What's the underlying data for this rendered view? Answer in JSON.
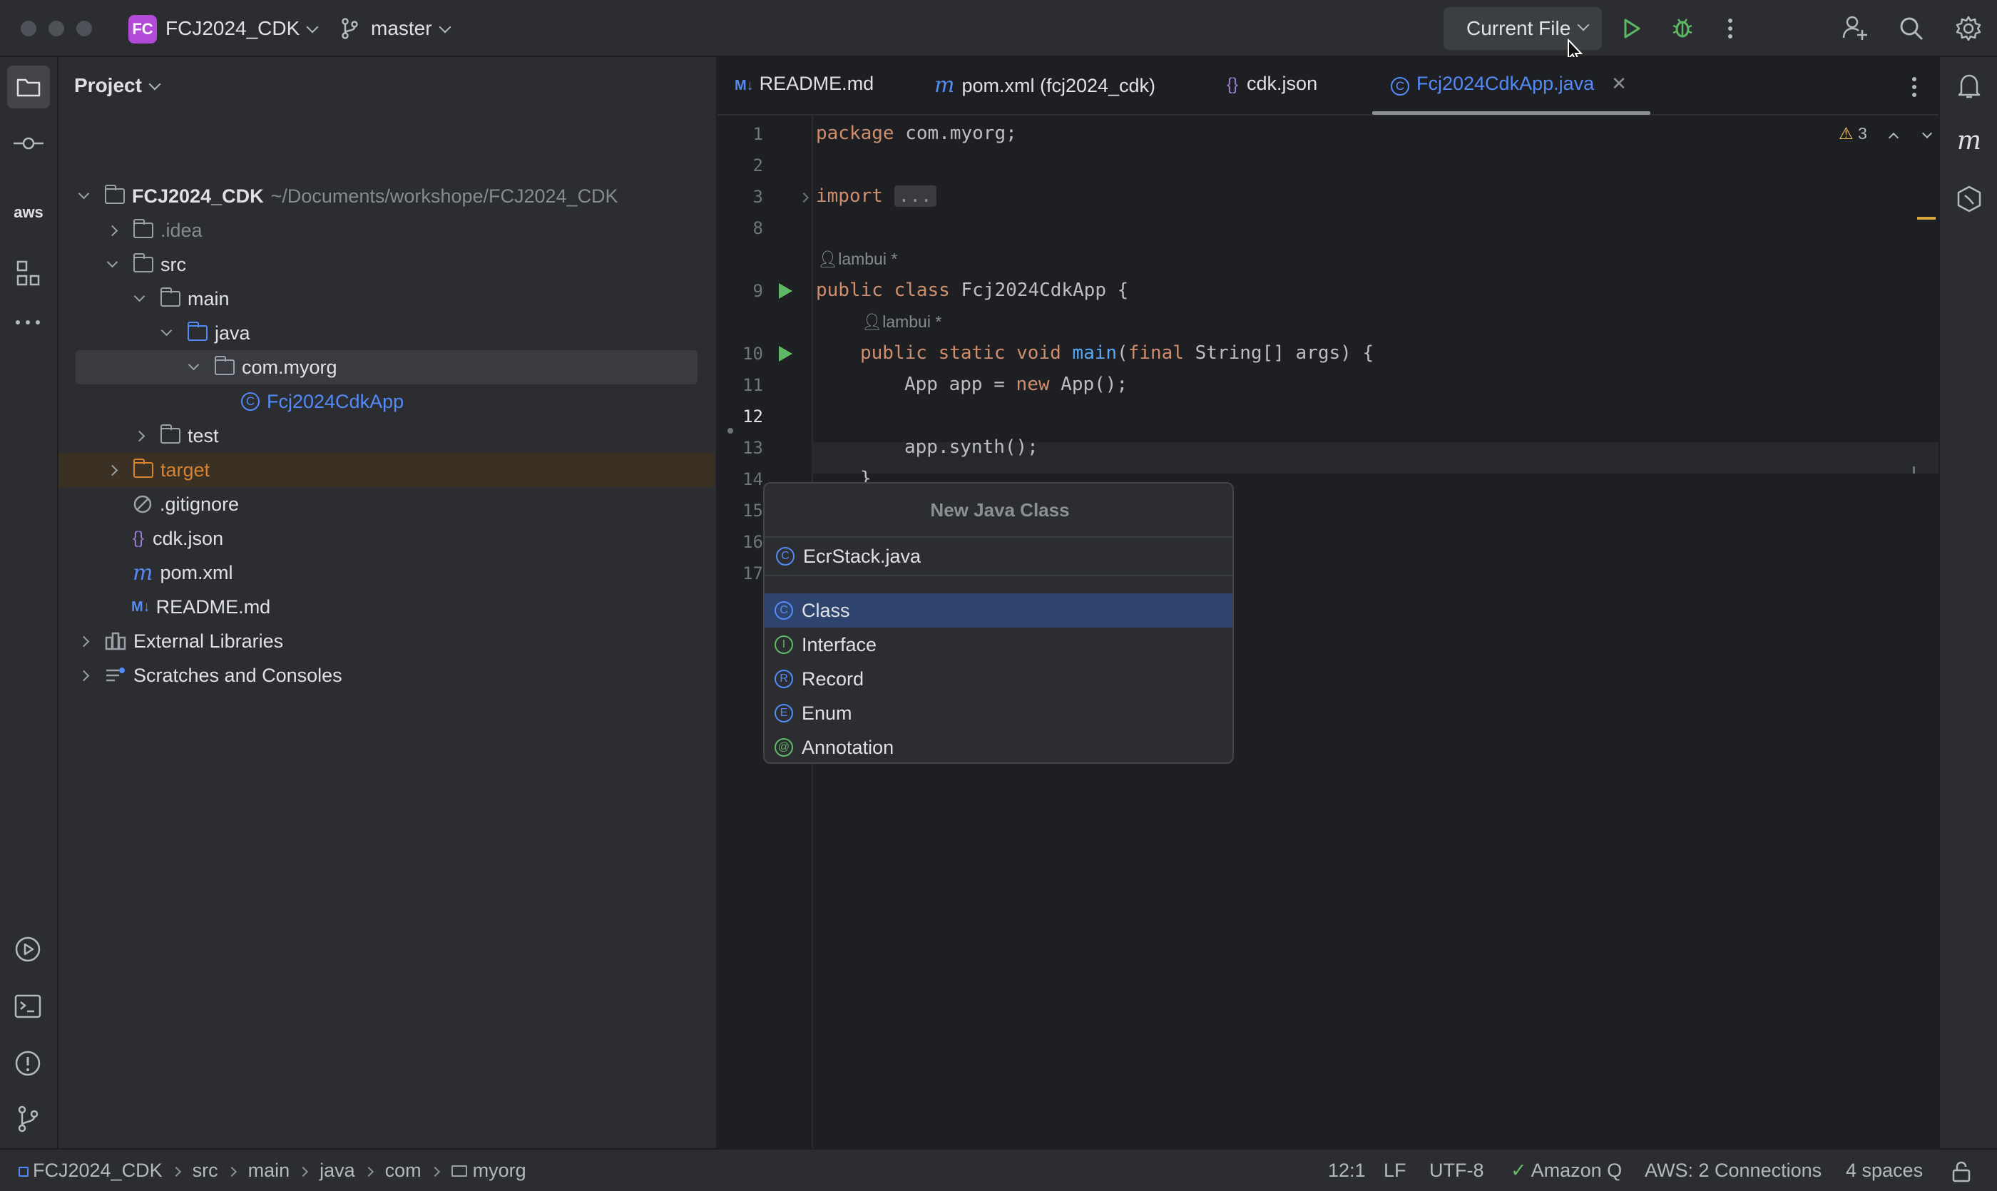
{
  "titlebar": {
    "project_badge": "FC",
    "project_name": "FCJ2024_CDK",
    "branch": "master",
    "run_config": "Current File"
  },
  "project_panel": {
    "title": "Project",
    "root_name": "FCJ2024_CDK",
    "root_path": "~/Documents/workshope/FCJ2024_CDK",
    "items": [
      {
        "label": ".idea"
      },
      {
        "label": "src"
      },
      {
        "label": "main"
      },
      {
        "label": "java"
      },
      {
        "label": "com.myorg"
      },
      {
        "label": "Fcj2024CdkApp"
      },
      {
        "label": "test"
      },
      {
        "label": "target"
      },
      {
        "label": ".gitignore"
      },
      {
        "label": "cdk.json"
      },
      {
        "label": "pom.xml"
      },
      {
        "label": "README.md"
      },
      {
        "label": "External Libraries"
      },
      {
        "label": "Scratches and Consoles"
      }
    ]
  },
  "tabs": [
    {
      "label": "README.md",
      "icon": "M↓"
    },
    {
      "label": "pom.xml (fcj2024_cdk)",
      "icon": "m"
    },
    {
      "label": "cdk.json",
      "icon": "{}"
    },
    {
      "label": "Fcj2024CdkApp.java",
      "icon": "C"
    }
  ],
  "editor": {
    "line_numbers": [
      "1",
      "2",
      "3",
      "8",
      "",
      "9",
      "",
      "10",
      "11",
      "12",
      "13",
      "14",
      "15",
      "16",
      "17"
    ],
    "author": "lambui *",
    "import_fold": "...",
    "warnings_count": "3",
    "code": {
      "l1_kw": "package",
      "l1_rest": " com.myorg;",
      "l3_kw": "import",
      "l9_kw": "public class",
      "l9_rest": " Fcj2024CdkApp {",
      "l10_kw": "public static void",
      "l10_fn": " main",
      "l10_p1": "(",
      "l10_kw2": "final",
      "l10_rest": " String[] args) {",
      "l11_a": "App app = ",
      "l11_kw": "new",
      "l11_b": " App();",
      "l13": "app.synth();",
      "l14": "}"
    }
  },
  "popup": {
    "title": "New Java Class",
    "input_value": "EcrStack.java",
    "items": [
      {
        "label": "Class",
        "glyph": "C",
        "color": "#548af7"
      },
      {
        "label": "Interface",
        "glyph": "I",
        "color": "#5fb865"
      },
      {
        "label": "Record",
        "glyph": "R",
        "color": "#548af7"
      },
      {
        "label": "Enum",
        "glyph": "E",
        "color": "#548af7"
      },
      {
        "label": "Annotation",
        "glyph": "@",
        "color": "#5fb865"
      }
    ]
  },
  "statusbar": {
    "breadcrumb": [
      "FCJ2024_CDK",
      "src",
      "main",
      "java",
      "com",
      "myorg"
    ],
    "position": "12:1",
    "line_ending": "LF",
    "encoding": "UTF-8",
    "amazon_q": "Amazon Q",
    "aws": "AWS: 2 Connections",
    "indent": "4 spaces"
  },
  "left_toolbar": {
    "aws_label": "aws"
  },
  "right_toolbar": {
    "maven_label": "m"
  }
}
